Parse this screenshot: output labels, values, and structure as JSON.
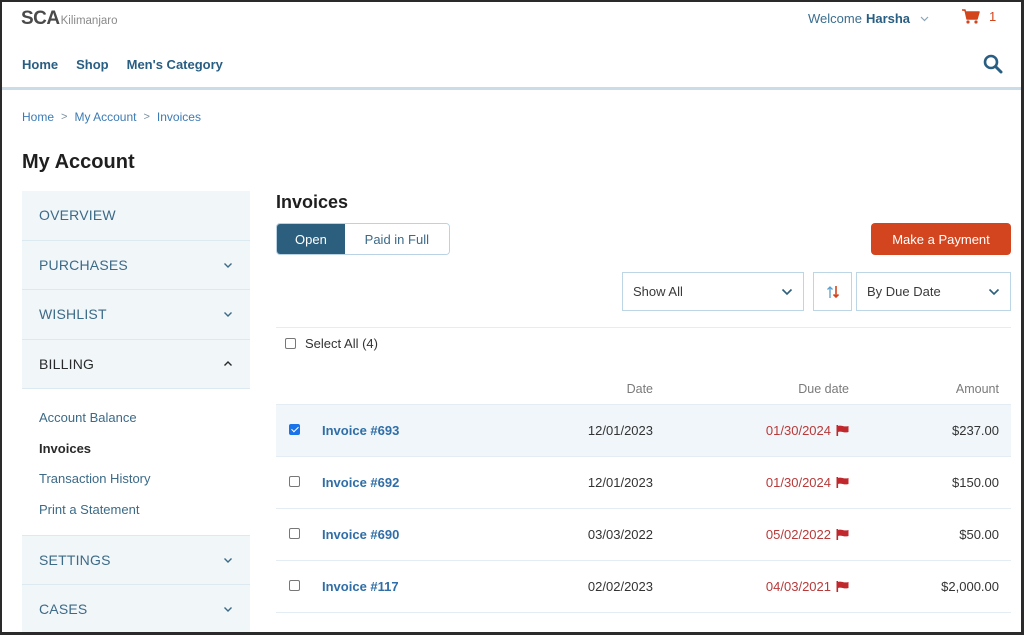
{
  "header": {
    "logo_main": "SCA",
    "logo_sub": "Kilimanjaro",
    "welcome_prefix": "Welcome",
    "user_name": "Harsha",
    "cart_count": "1",
    "nav": [
      "Home",
      "Shop",
      "Men's Category"
    ]
  },
  "breadcrumb": [
    "Home",
    "My Account",
    "Invoices"
  ],
  "page_title": "My Account",
  "sidebar": {
    "items": [
      {
        "label": "OVERVIEW",
        "chevron": "none"
      },
      {
        "label": "PURCHASES",
        "chevron": "down"
      },
      {
        "label": "WISHLIST",
        "chevron": "down"
      },
      {
        "label": "BILLING",
        "chevron": "up"
      }
    ],
    "billing_sub": [
      "Account Balance",
      "Invoices",
      "Transaction History",
      "Print a Statement"
    ],
    "billing_current": "Invoices",
    "items_after": [
      {
        "label": "SETTINGS",
        "chevron": "down"
      },
      {
        "label": "CASES",
        "chevron": "down"
      }
    ]
  },
  "main": {
    "title": "Invoices",
    "tabs": [
      {
        "label": "Open",
        "active": true
      },
      {
        "label": "Paid in Full",
        "active": false
      }
    ],
    "pay_button": "Make a Payment",
    "filter_select": "Show All",
    "sort_select": "By Due Date",
    "select_all": "Select All (4)",
    "columns": {
      "date": "Date",
      "due": "Due date",
      "amount": "Amount"
    },
    "invoices": [
      {
        "name": "Invoice #693",
        "date": "12/01/2023",
        "due": "01/30/2024",
        "amount": "$237.00",
        "checked": true,
        "overdue": true
      },
      {
        "name": "Invoice #692",
        "date": "12/01/2023",
        "due": "01/30/2024",
        "amount": "$150.00",
        "checked": false,
        "overdue": true
      },
      {
        "name": "Invoice #690",
        "date": "03/03/2022",
        "due": "05/02/2022",
        "amount": "$50.00",
        "checked": false,
        "overdue": true
      },
      {
        "name": "Invoice #117",
        "date": "02/02/2023",
        "due": "04/03/2021",
        "amount": "$2,000.00",
        "checked": false,
        "overdue": true
      }
    ]
  },
  "colors": {
    "brand_blue": "#285e82",
    "accent_orange": "#d2451e",
    "overdue_red": "#b73a3a",
    "link_blue": "#2f6ea6"
  }
}
